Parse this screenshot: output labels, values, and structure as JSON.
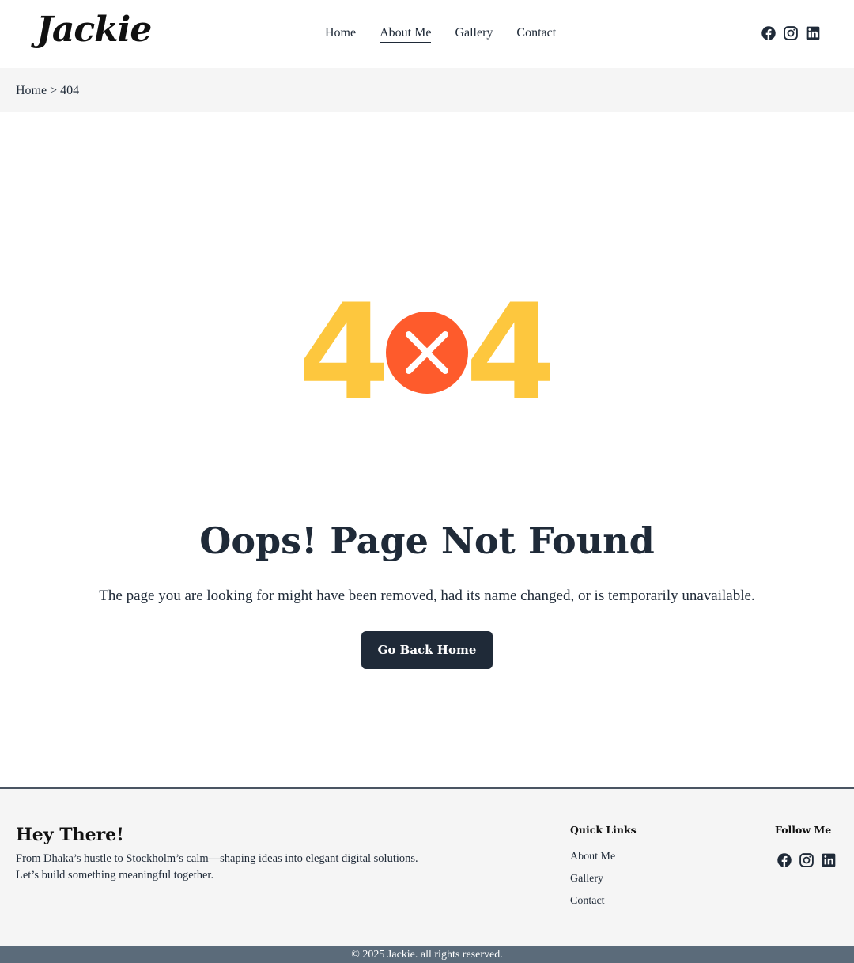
{
  "header": {
    "logo": "Jackie",
    "nav": [
      {
        "label": "Home"
      },
      {
        "label": "About Me"
      },
      {
        "label": "Gallery"
      },
      {
        "label": "Contact"
      }
    ],
    "active_nav": "About Me",
    "social_icons": [
      "facebook-icon",
      "instagram-icon",
      "linkedin-icon"
    ]
  },
  "breadcrumb": {
    "home": "Home",
    "separator": ">",
    "current": "404"
  },
  "error": {
    "graphic_left": "4",
    "graphic_right": "4",
    "graphic_center_icon": "x-circle-icon",
    "title": "Oops! Page Not Found",
    "description": "The page you are looking for might have been removed, had its name changed, or is temporarily unavailable.",
    "button_label": "Go Back Home"
  },
  "footer": {
    "title": "Hey There!",
    "text_line1": "From Dhaka’s hustle to Stockholm’s calm—shaping ideas into elegant digital solutions.",
    "text_line2": "Let’s build something meaningful together.",
    "quick_links_heading": "Quick Links",
    "quick_links": [
      {
        "label": "About Me"
      },
      {
        "label": "Gallery"
      },
      {
        "label": "Contact"
      }
    ],
    "follow_heading": "Follow Me",
    "copyright": "© 2025 Jackie. all rights reserved."
  },
  "colors": {
    "primary": "#1f2a38",
    "accent_yellow": "#fdc73e",
    "accent_red": "#fe5b2c",
    "footer_bar": "#5b6b7a",
    "light_bg": "#f5f5f5"
  }
}
